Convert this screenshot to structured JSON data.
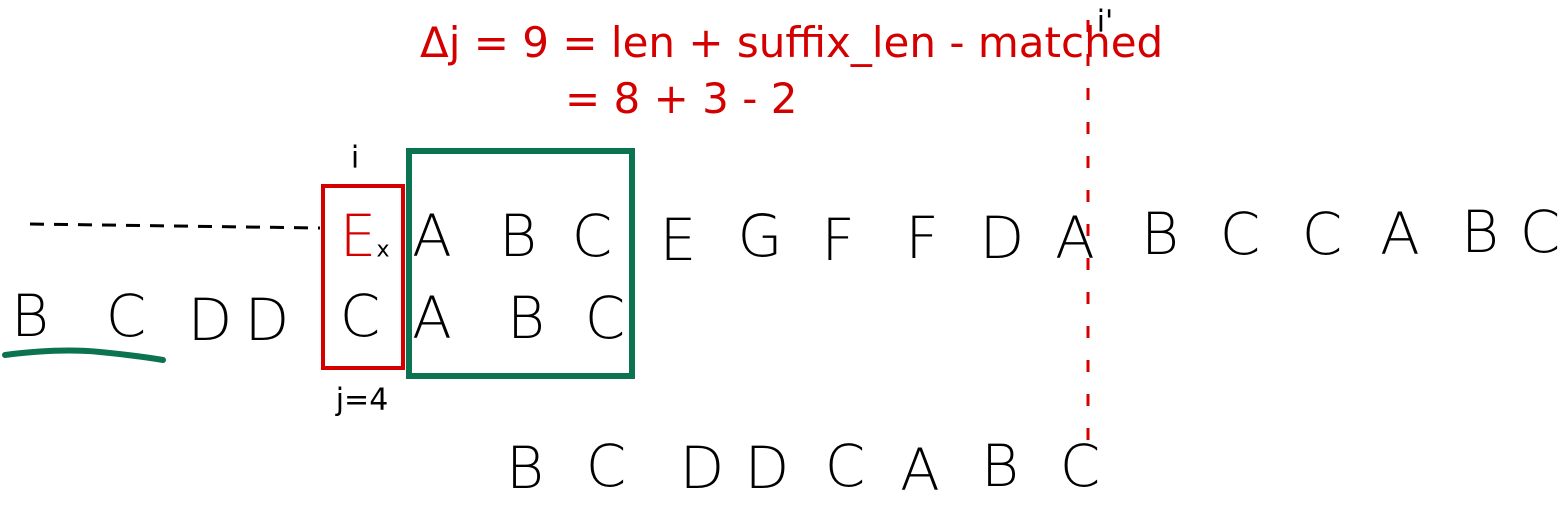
{
  "formula": {
    "line1": "Δj = 9 = len + suffix_len - matched",
    "line2": "= 8 + 3 - 2",
    "marker": "i'"
  },
  "labels": {
    "i": "i",
    "j": "j=4",
    "mismatch_mark": "x"
  },
  "text_row": [
    "E",
    "A",
    "B",
    "C",
    "E",
    "G",
    "F",
    "F",
    "D",
    "A",
    "B",
    "C",
    "C",
    "A",
    "B",
    "C"
  ],
  "pattern_row": [
    "B",
    "C",
    "D",
    "D",
    "C",
    "A",
    "B",
    "C"
  ],
  "shifted_pattern_row": [
    "B",
    "C",
    "D",
    "D",
    "C",
    "A",
    "B",
    "C"
  ],
  "colors": {
    "mismatch": "#d40000",
    "match_box": "#0b7350",
    "ink": "#000000"
  }
}
